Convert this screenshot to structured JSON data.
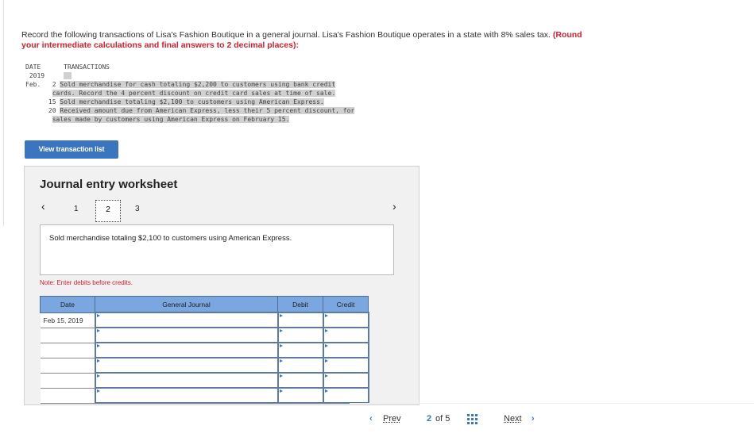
{
  "instructions": {
    "text": "Record the following transactions of Lisa's Fashion Boutique in a general journal. Lisa's Fashion Boutique operates in a state with 8% sales tax.",
    "emphasis": "(Round your intermediate calculations and final answers to 2 decimal places):"
  },
  "transactions": {
    "header_date": "DATE",
    "header_tx": "TRANSACTIONS",
    "year": "2019",
    "month": "Feb.",
    "items": [
      {
        "day": "2",
        "lines": [
          "Sold merchandise for cash totaling $2,200 to customers using bank credit",
          "cards. Record the 4 percent discount on credit card sales at time of sale."
        ]
      },
      {
        "day": "15",
        "lines": [
          "Sold merchandise totaling $2,100 to customers using American Express."
        ]
      },
      {
        "day": "20",
        "lines": [
          "Received amount due from American Express, less their 5 percent discount, for",
          "sales made by customers using American Express on February 15."
        ]
      }
    ]
  },
  "view_button": "View transaction list",
  "worksheet": {
    "title": "Journal entry worksheet",
    "pages": [
      "1",
      "2",
      "3"
    ],
    "current_page": 2,
    "prev_icon": "chevron-left",
    "next_icon": "chevron-right",
    "description": "Sold merchandise totaling $2,100 to customers using American Express.",
    "note": "Note: Enter debits before credits.",
    "columns": [
      "Date",
      "General Journal",
      "Debit",
      "Credit"
    ],
    "rows": [
      {
        "date": "Feb 15, 2019"
      },
      {
        "date": ""
      },
      {
        "date": ""
      },
      {
        "date": ""
      },
      {
        "date": ""
      },
      {
        "date": ""
      }
    ]
  },
  "pagination": {
    "prev": "Prev",
    "current": "2",
    "of": "of 5",
    "next": "Next",
    "grid_icon": "grid-icon"
  }
}
